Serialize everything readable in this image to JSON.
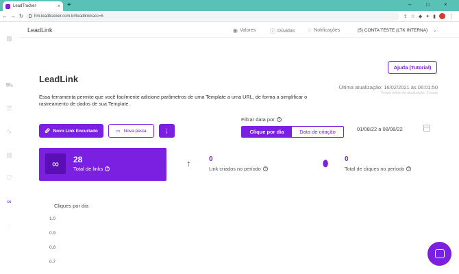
{
  "browser": {
    "tab_title": "LeadTracker",
    "tab_close": "×",
    "new_tab": "+",
    "url": "hm.leadtracker.com.br/leadlink#acc=5",
    "window_controls": [
      "–",
      "□",
      "×"
    ]
  },
  "header": {
    "brand": "LeadLink",
    "links": [
      {
        "label": "Valores",
        "icon": "eye-icon"
      },
      {
        "label": "Dúvidas",
        "icon": "help-icon"
      },
      {
        "label": "Notificações",
        "icon": "bell-icon"
      }
    ],
    "account": "(5) CONTA TESTE (LTK INTERNA)"
  },
  "main": {
    "help_button": "Ajuda (Tutorial)",
    "title": "LeadLink",
    "last_update": "Última atualização: 16/02/2021 às 06:01:50",
    "avg_time": "Tempo médio de atualização: 3 horas",
    "description": "Essa ferramenta permite que você facilmente adicione parâmetros de uma Template a uma URL, de forma a simplificar o rastreamento de dados de sua Template.",
    "buttons": {
      "new_link": "Novo Link Encurtado",
      "new_folder": "Nova pasta",
      "more": "⋮"
    },
    "filter": {
      "label": "Filtrar data por",
      "options": [
        "Clique por dia",
        "Data de criação"
      ],
      "selected": "Clique por dia",
      "date_range": "01/08/22 a 08/08/22"
    },
    "stats": {
      "total_links": {
        "value": "28",
        "label": "Total de links"
      },
      "links_created": {
        "value": "0",
        "label": "Link criados no período"
      },
      "total_clicks": {
        "value": "0",
        "label": "Total de cliques no período"
      }
    },
    "chart": {
      "title": "Cliques por dia",
      "y_ticks": [
        "1.0",
        "0.9",
        "0.8",
        "0.7"
      ]
    }
  },
  "colors": {
    "accent": "#7b1fe0",
    "browser_tab_bar": "#5ac1b6"
  }
}
